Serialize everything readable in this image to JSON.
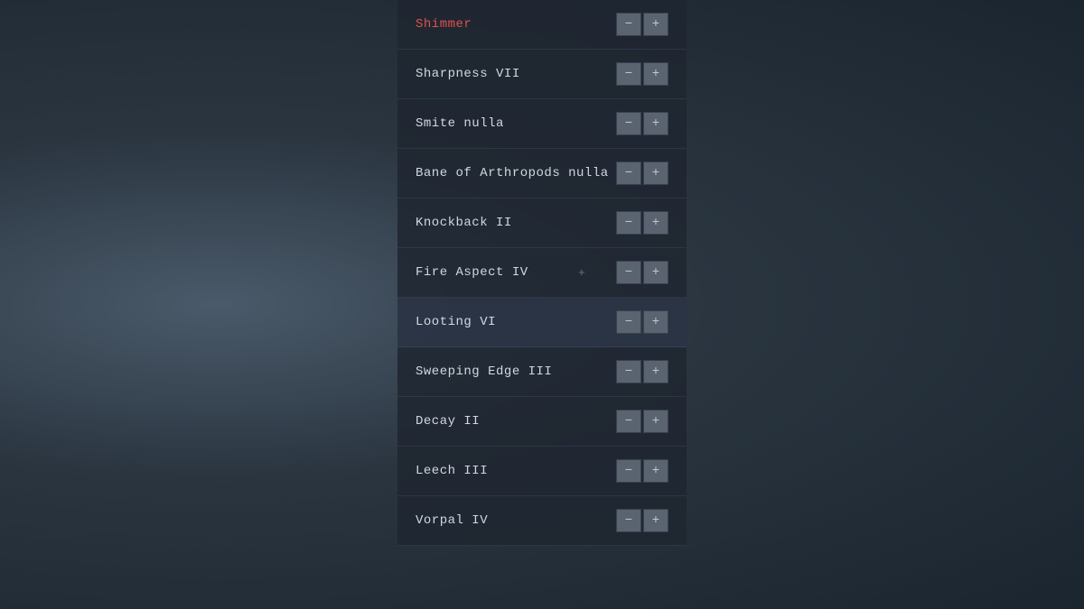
{
  "enchantments": [
    {
      "id": "shimmer",
      "name": "Shimmer",
      "nameClass": "red",
      "highlighted": false
    },
    {
      "id": "sharpness",
      "name": "Sharpness VII",
      "nameClass": "",
      "highlighted": false
    },
    {
      "id": "smite",
      "name": "Smite nulla",
      "nameClass": "",
      "highlighted": false
    },
    {
      "id": "bane",
      "name": "Bane of Arthropods nulla",
      "nameClass": "",
      "highlighted": false
    },
    {
      "id": "knockback",
      "name": "Knockback II",
      "nameClass": "",
      "highlighted": false
    },
    {
      "id": "fire-aspect",
      "name": "Fire Aspect IV",
      "nameClass": "",
      "highlighted": false,
      "hasPlus": true
    },
    {
      "id": "looting",
      "name": "Looting VI",
      "nameClass": "",
      "highlighted": true
    },
    {
      "id": "sweeping-edge",
      "name": "Sweeping Edge III",
      "nameClass": "",
      "highlighted": false
    },
    {
      "id": "decay",
      "name": "Decay II",
      "nameClass": "",
      "highlighted": false
    },
    {
      "id": "leech",
      "name": "Leech III",
      "nameClass": "",
      "highlighted": false
    },
    {
      "id": "vorpal",
      "name": "Vorpal IV",
      "nameClass": "",
      "highlighted": false
    }
  ],
  "buttons": {
    "minus": "−",
    "plus": "+"
  }
}
